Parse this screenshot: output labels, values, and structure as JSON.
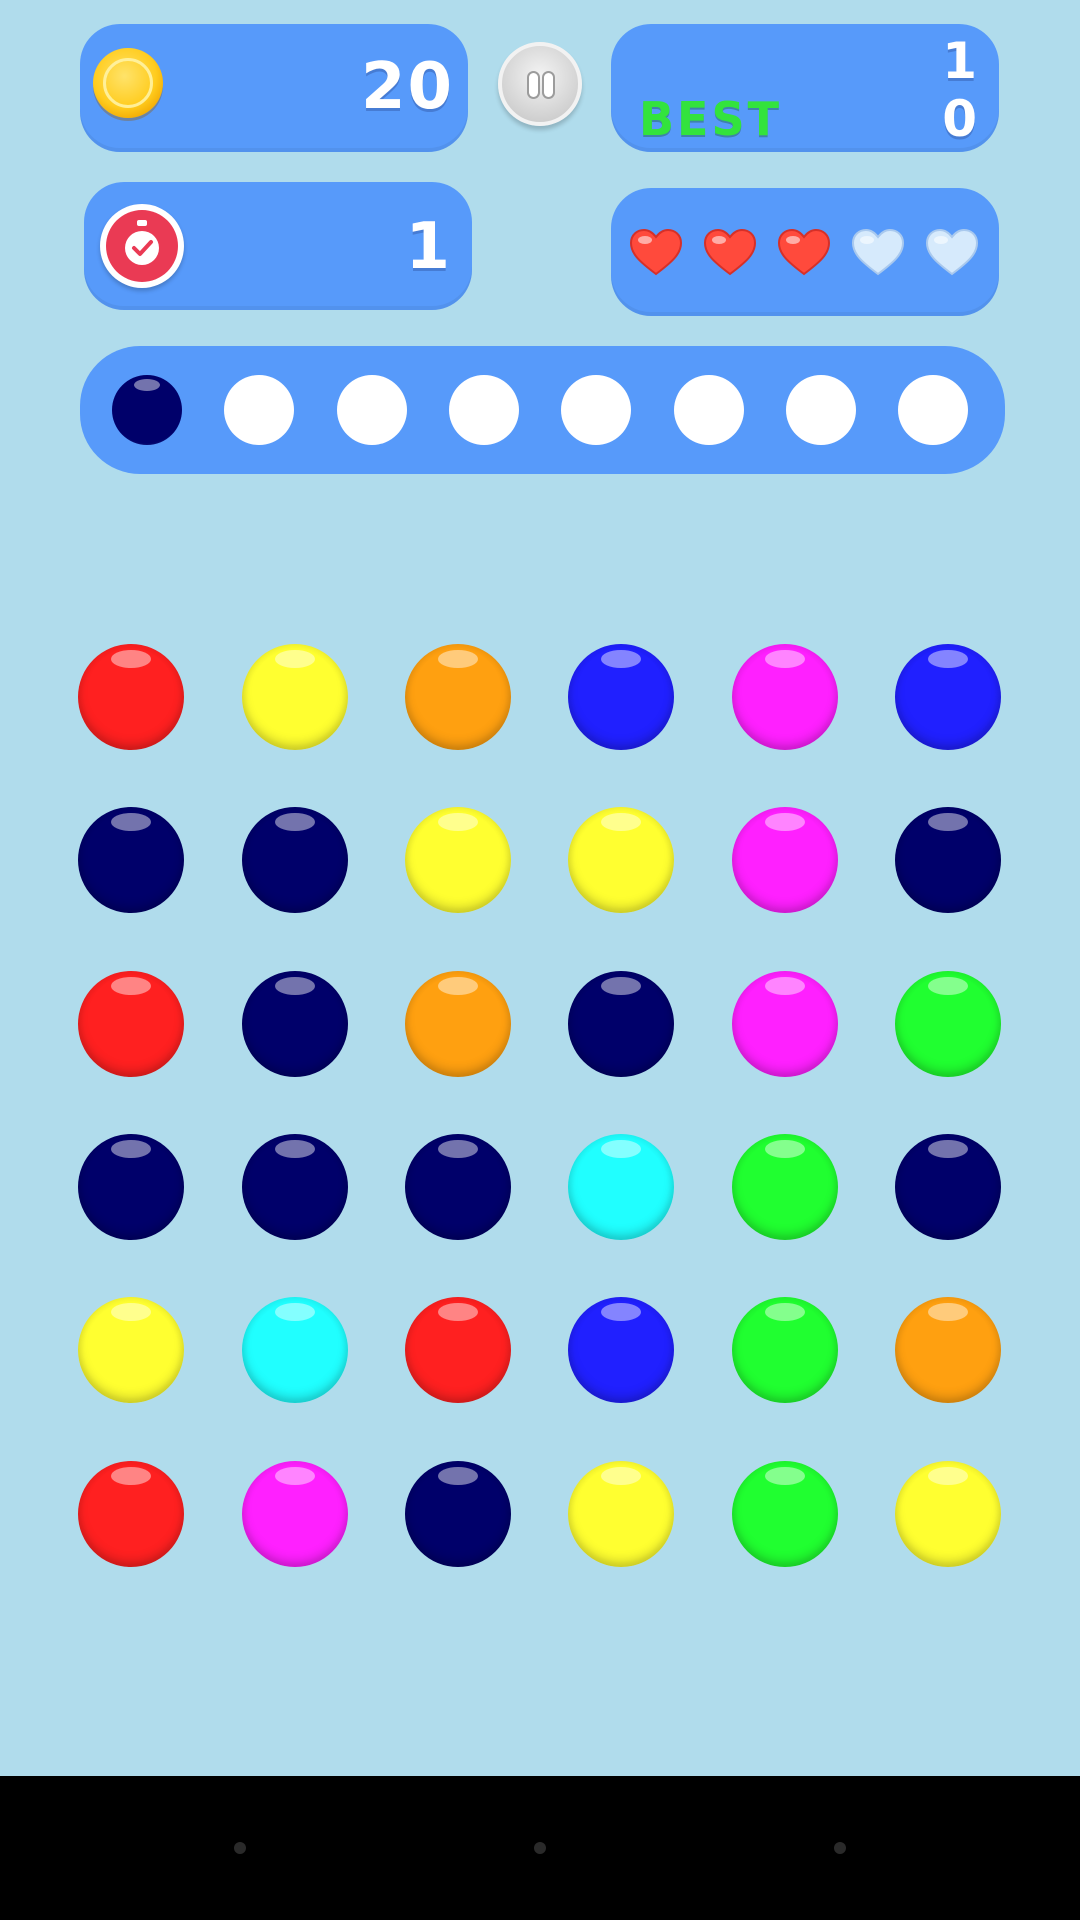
{
  "hud": {
    "coins": "20",
    "score": "1",
    "best_label": "BEST",
    "best": "0",
    "timer": "1",
    "lives_total": 5,
    "lives_remaining": 3
  },
  "colors": {
    "red": "#ff2020",
    "yellow": "#ffff30",
    "orange": "#ffa010",
    "blue": "#2020ff",
    "magenta": "#ff20ff",
    "navy": "#00006a",
    "green": "#20ff30",
    "cyan": "#20ffff",
    "heart_full": "#ff4a3c",
    "heart_empty": "#d6eafc",
    "panel": "#579afa",
    "background": "#b0dcec"
  },
  "sequence": {
    "slot_count": 8,
    "filled": [
      "navy"
    ]
  },
  "board": {
    "rows": [
      [
        "red",
        "yellow",
        "orange",
        "blue",
        "magenta",
        "blue"
      ],
      [
        "navy",
        "navy",
        "yellow",
        "yellow",
        "magenta",
        "navy"
      ],
      [
        "red",
        "navy",
        "orange",
        "navy",
        "magenta",
        "green"
      ],
      [
        "navy",
        "navy",
        "navy",
        "cyan",
        "green",
        "navy"
      ],
      [
        "yellow",
        "cyan",
        "red",
        "blue",
        "green",
        "orange"
      ],
      [
        "red",
        "magenta",
        "navy",
        "yellow",
        "green",
        "yellow"
      ]
    ]
  }
}
